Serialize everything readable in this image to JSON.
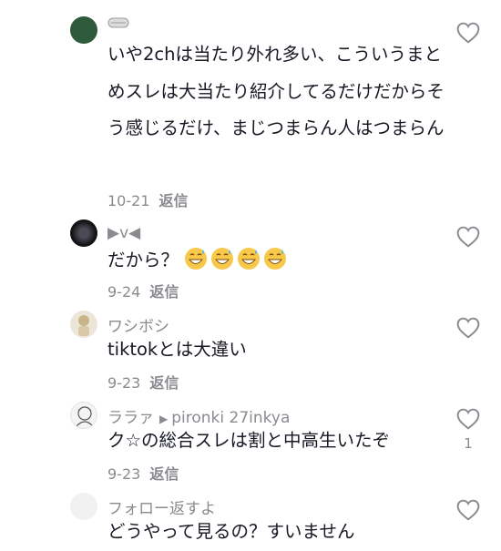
{
  "comments": [
    {
      "username": "",
      "text": "いや2chは当たり外れ多い、こういうまとめスレは大当たり紹介してるだけだからそう感じるだけ、まじつまらん人はつまらん",
      "date": "10-21",
      "reply_label": "返信",
      "likes": ""
    },
    {
      "username": "▶v◀",
      "text": "だから？",
      "emojis": [
        "grinning-sweat-emoji",
        "grinning-sweat-emoji",
        "grinning-sweat-emoji",
        "grinning-sweat-emoji"
      ],
      "date": "9-24",
      "reply_label": "返信",
      "likes": ""
    },
    {
      "username": "ワシボシ",
      "text": "tiktokとは大違い",
      "date": "9-23",
      "reply_label": "返信",
      "likes": ""
    },
    {
      "username": "ララァ",
      "reply_to": "pironki 27inkya",
      "text": "ク☆の総合スレは割と中高生いたぞ",
      "date": "9-23",
      "reply_label": "返信",
      "likes": "1"
    },
    {
      "username": "フォロー返すよ",
      "text": "どうやって見るの？すいません",
      "date": "",
      "reply_label": "",
      "likes": ""
    }
  ],
  "colors": {
    "text": "#161823",
    "muted": "#8a8b91",
    "emoji": "#f7c84a"
  }
}
